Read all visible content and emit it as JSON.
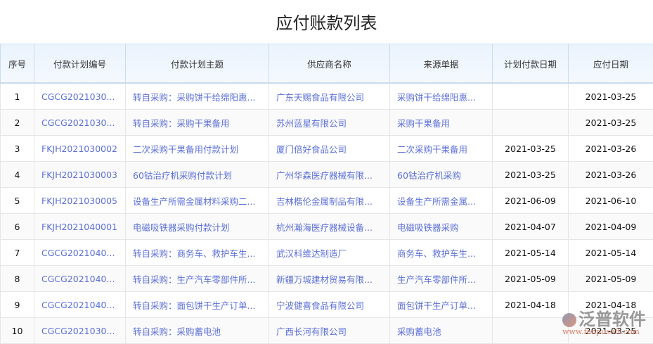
{
  "title": "应付账款列表",
  "columns": [
    "序号",
    "付款计划编号",
    "付款计划主题",
    "供应商名称",
    "来源单据",
    "计划付款日期",
    "应付日期"
  ],
  "rows": [
    [
      "1",
      "CGCG2021030...",
      "转自采购：采购饼干给绵阳惠...",
      "广东天赐食品有限公司",
      "采购饼干给绵阳惠...",
      "",
      "2021-03-25"
    ],
    [
      "2",
      "CGCG2021030...",
      "转自采购：采购干果备用",
      "苏州蓝星有限公司",
      "采购干果备用",
      "",
      "2021-03-25"
    ],
    [
      "3",
      "FKJH2021030002",
      "二次采购干果备用付款计划",
      "厦门倍好食品公司",
      "二次采购干果备用",
      "2021-03-25",
      "2021-03-26"
    ],
    [
      "4",
      "FKJH2021030003",
      "60钴治疗机采购付款计划",
      "广州华森医疗器械有限...",
      "60钴治疗机采购",
      "2021-03-25",
      "2021-03-26"
    ],
    [
      "5",
      "FKJH2021030005",
      "设备生产所需金属材料采购二...",
      "吉林楷伦金属制品有限...",
      "设备生产所需金属...",
      "2021-06-09",
      "2021-06-10"
    ],
    [
      "6",
      "FKJH2021040001",
      "电磁吸铁器采购付款计划",
      "杭州瀚海医疗器械设备...",
      "电磁吸铁器采购",
      "2021-04-07",
      "2021-04-09"
    ],
    [
      "7",
      "CGCG2021040...",
      "转自采购：商务车、救护车生...",
      "武汉科维达制造厂",
      "商务车、救护车生...",
      "2021-05-14",
      "2021-05-14"
    ],
    [
      "8",
      "CGCG2021040...",
      "转自采购：生产汽车零部件所...",
      "新疆万城建材贸易有限...",
      "生产汽车零部件所...",
      "2021-05-09",
      "2021-05-09"
    ],
    [
      "9",
      "CGCG2021040...",
      "转自采购：面包饼干生产订单...",
      "宁波健喜食品有限公司",
      "面包饼干生产订单...",
      "2021-04-18",
      "2021-04-18"
    ],
    [
      "10",
      "CGCG2021030...",
      "转自采购：采购蓄电池",
      "广西长河有限公司",
      "采购蓄电池",
      "",
      "2021-03-25"
    ]
  ],
  "watermark": {
    "logo": "泛普软件",
    "url": "www.fanpusoft.com"
  }
}
